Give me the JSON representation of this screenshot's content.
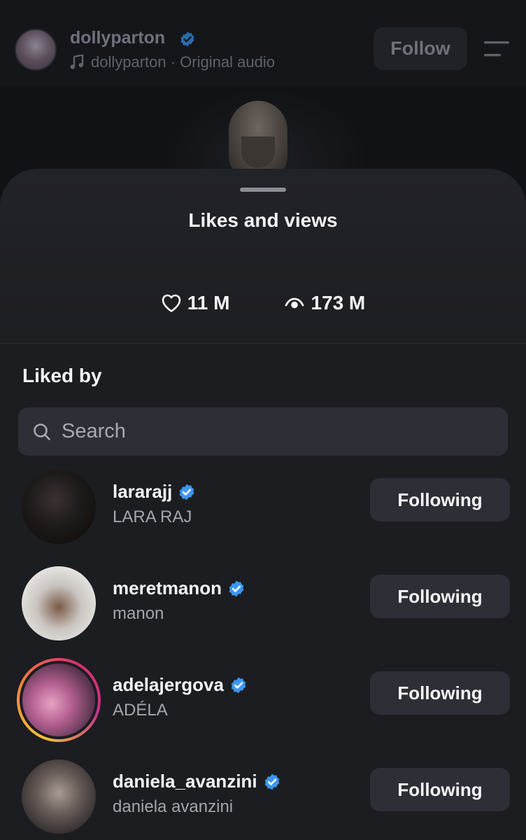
{
  "background_reel": {
    "username": "dollyparton",
    "audio_text": "dollyparton · Original audio",
    "follow_label": "Follow",
    "verified": true,
    "icons": [
      "music-note-icon",
      "verified-badge-icon",
      "menu-icon"
    ]
  },
  "sheet": {
    "title": "Likes and views",
    "likes": {
      "icon": "heart-icon",
      "value": "11 M"
    },
    "views": {
      "icon": "eye-icon",
      "value": "173 M"
    },
    "liked_by_heading": "Liked by",
    "search": {
      "placeholder": "Search",
      "value": ""
    },
    "users": [
      {
        "username": "lararajj",
        "full_name": "LARA RAJ",
        "verified": true,
        "button": "Following",
        "story_ring": false
      },
      {
        "username": "meretmanon",
        "full_name": "manon",
        "verified": true,
        "button": "Following",
        "story_ring": false
      },
      {
        "username": "adelajergova",
        "full_name": "ADÉLA",
        "verified": true,
        "button": "Following",
        "story_ring": true
      },
      {
        "username": "daniela_avanzini",
        "full_name": "daniela avanzini",
        "verified": true,
        "button": "Following",
        "story_ring": false
      }
    ]
  },
  "colors": {
    "verified_blue": "#3b97f0",
    "sheet_bg": "#1b1d21",
    "button_bg": "#2c2f35",
    "story_ring": [
      "#f9c33a",
      "#f5853f",
      "#e1306c",
      "#c13584"
    ]
  }
}
